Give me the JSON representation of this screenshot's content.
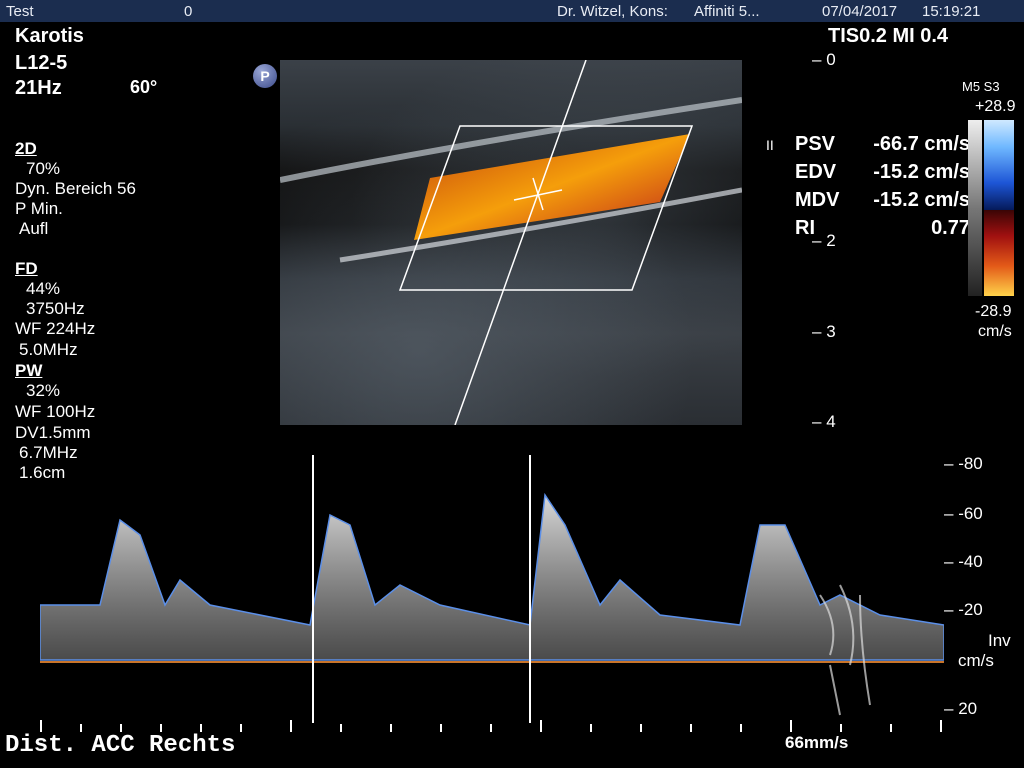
{
  "header": {
    "patient": "Test",
    "patient_id": "0",
    "physician": "Dr. Witzel, Kons:",
    "system": "Affiniti 5...",
    "date": "07/04/2017",
    "time": "15:19:21"
  },
  "exam": {
    "preset": "Karotis",
    "probe": "L12-5",
    "frame_rate": "21Hz",
    "angle": "60°",
    "tis_mi": "TIS0.2  MI 0.4"
  },
  "params_2d": {
    "title": "2D",
    "gain": "70%",
    "dyn": "Dyn. Bereich 56",
    "pmode": "P Min.",
    "res": "Aufl"
  },
  "params_fd": {
    "title": "FD",
    "gain": "44%",
    "prf": "3750Hz",
    "wf": "WF 224Hz",
    "freq": "5.0MHz"
  },
  "params_pw": {
    "title": "PW",
    "gain": "32%",
    "wf": "WF 100Hz",
    "dv": "DV1.5mm",
    "freq": "6.7MHz",
    "depth": "1.6cm"
  },
  "measurements": [
    {
      "label": "PSV",
      "value": "-66.7 cm/s"
    },
    {
      "label": "EDV",
      "value": "-15.2 cm/s"
    },
    {
      "label": "MDV",
      "value": "-15.2 cm/s"
    },
    {
      "label": "RI",
      "value": "0.77"
    }
  ],
  "color_scale": {
    "map": "M5 S3",
    "max": "+28.9",
    "min": "-28.9",
    "unit": "cm/s"
  },
  "depth_scale": [
    "0",
    "2",
    "3",
    "4"
  ],
  "velocity_scale": [
    "-80",
    "-60",
    "-40",
    "-20",
    "20"
  ],
  "velocity_unit_top": "Inv",
  "velocity_unit": "cm/s",
  "sweep_speed": "66mm/s",
  "annotation": "Dist. ACC  Rechts",
  "pause_marker": "II",
  "probe_badge": "P",
  "colors": {
    "baseline": "#c8742a",
    "envelope": "#5b8fe8",
    "topbar": "#1b2d4f"
  }
}
